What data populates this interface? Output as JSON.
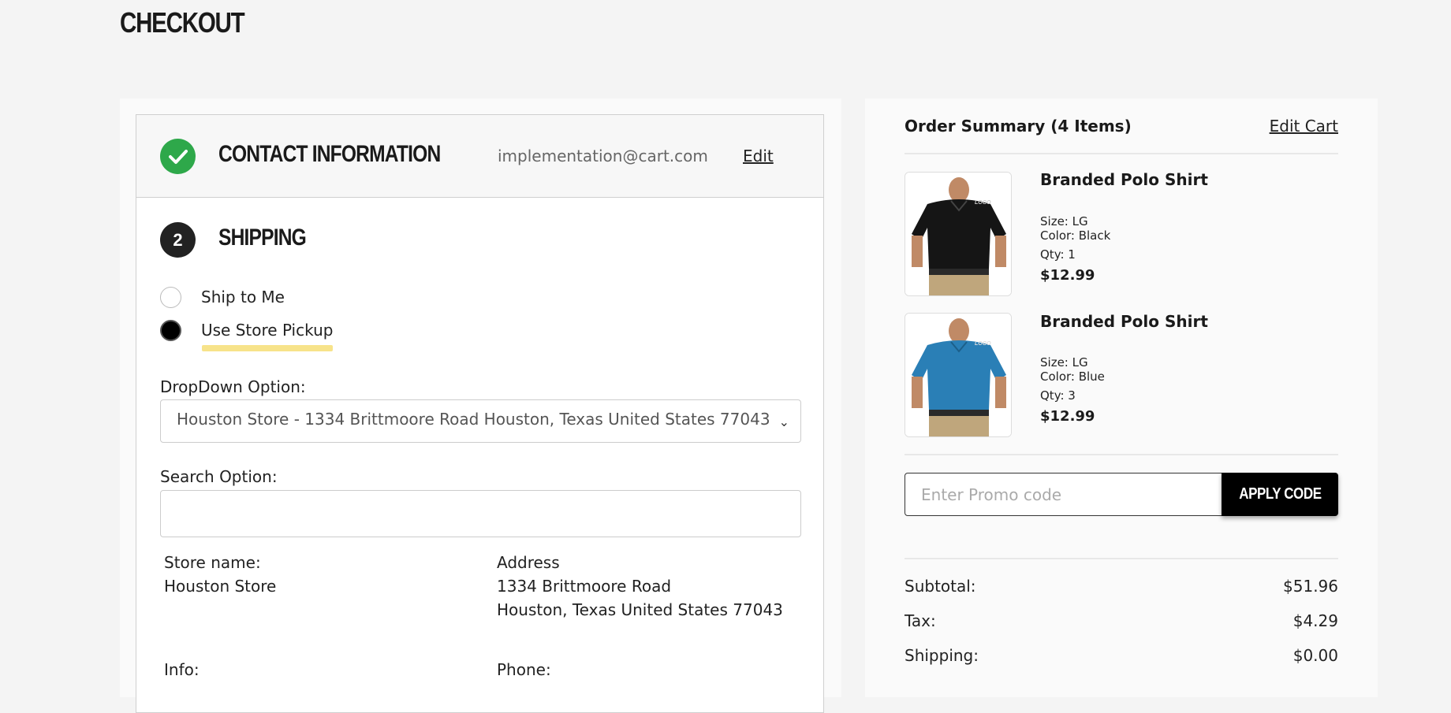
{
  "page": {
    "title": "CHECKOUT"
  },
  "contact": {
    "heading": "CONTACT INFORMATION",
    "email": "implementation@cart.com",
    "edit_label": "Edit",
    "status_color": "#2ea84a"
  },
  "shipping": {
    "step_number": "2",
    "heading": "SHIPPING",
    "options": [
      {
        "label": "Ship to Me",
        "selected": false
      },
      {
        "label": "Use Store Pickup",
        "selected": true
      }
    ],
    "dropdown_label": "DropDown Option:",
    "dropdown_value": "Houston Store - 1334 Brittmoore Road Houston, Texas United States 77043",
    "search_label": "Search Option:",
    "search_value": "",
    "store": {
      "name_label": "Store name:",
      "name_value": "Houston Store",
      "address_label": "Address",
      "address_line1": "1334 Brittmoore Road",
      "address_line2": "Houston, Texas United States 77043",
      "info_label": "Info:",
      "phone_label": "Phone:"
    }
  },
  "summary": {
    "title": "Order Summary (4 Items)",
    "edit_cart_label": "Edit Cart",
    "items": [
      {
        "name": "Branded Polo Shirt",
        "size": "Size: LG",
        "color": "Color: Black",
        "qty": "Qty: 1",
        "price": "$12.99",
        "shirt_color": "#151515",
        "logo": "LOGO"
      },
      {
        "name": "Branded Polo Shirt",
        "size": "Size: LG",
        "color": "Color: Blue",
        "qty": "Qty: 3",
        "price": "$12.99",
        "shirt_color": "#2a7fb6",
        "logo": "LOGO"
      }
    ],
    "promo_placeholder": "Enter Promo code",
    "apply_label": "APPLY CODE",
    "totals": [
      {
        "label": "Subtotal:",
        "value": "$51.96"
      },
      {
        "label": "Tax:",
        "value": "$4.29"
      },
      {
        "label": "Shipping:",
        "value": "$0.00"
      }
    ]
  }
}
